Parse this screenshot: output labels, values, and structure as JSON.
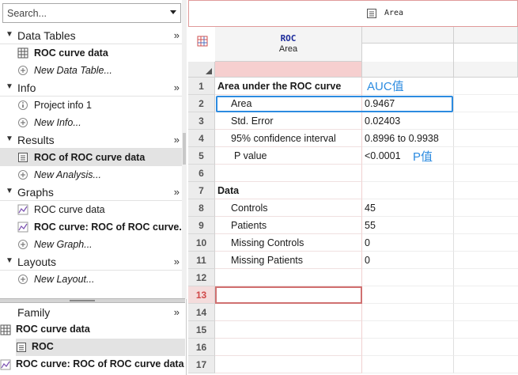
{
  "search": {
    "placeholder": "Search..."
  },
  "sections": [
    {
      "title": "Data Tables",
      "more": "»",
      "items": [
        {
          "label": "ROC curve data"
        },
        {
          "label": "New Data Table..."
        }
      ]
    },
    {
      "title": "Info",
      "more": "»",
      "items": [
        {
          "label": "Project info 1"
        },
        {
          "label": "New Info..."
        }
      ]
    },
    {
      "title": "Results",
      "more": "»",
      "items": [
        {
          "label": "ROC of ROC curve data"
        },
        {
          "label": "New Analysis..."
        }
      ]
    },
    {
      "title": "Graphs",
      "more": "»",
      "items": [
        {
          "label": "ROC curve data"
        },
        {
          "label": "ROC curve: ROC of ROC curve..."
        },
        {
          "label": "New Graph..."
        }
      ]
    },
    {
      "title": "Layouts",
      "more": "»",
      "items": [
        {
          "label": "New Layout..."
        }
      ]
    }
  ],
  "family": {
    "title": "Family",
    "more": "»",
    "items": [
      {
        "label": "ROC curve data"
      },
      {
        "label": "ROC"
      },
      {
        "label": "ROC curve: ROC of ROC curve data"
      }
    ]
  },
  "sheet": {
    "tab_title": "Area",
    "column_title": "ROC",
    "column_subtitle": "Area",
    "rows": [
      {
        "num": "1",
        "label": "Area under the ROC curve",
        "value": ""
      },
      {
        "num": "2",
        "label": "Area",
        "value": "0.9467"
      },
      {
        "num": "3",
        "label": "Std. Error",
        "value": "0.02403"
      },
      {
        "num": "4",
        "label": "95% confidence interval",
        "value": "0.8996 to 0.9938"
      },
      {
        "num": "5",
        "label": "P value",
        "value": "<0.0001"
      },
      {
        "num": "6",
        "label": "",
        "value": ""
      },
      {
        "num": "7",
        "label": "Data",
        "value": ""
      },
      {
        "num": "8",
        "label": "Controls",
        "value": "45"
      },
      {
        "num": "9",
        "label": "Patients",
        "value": "55"
      },
      {
        "num": "10",
        "label": "Missing Controls",
        "value": "0"
      },
      {
        "num": "11",
        "label": "Missing Patients",
        "value": "0"
      },
      {
        "num": "12",
        "label": "",
        "value": ""
      },
      {
        "num": "13",
        "label": "",
        "value": ""
      },
      {
        "num": "14",
        "label": "",
        "value": ""
      },
      {
        "num": "15",
        "label": "",
        "value": ""
      },
      {
        "num": "16",
        "label": "",
        "value": ""
      },
      {
        "num": "17",
        "label": "",
        "value": ""
      }
    ]
  },
  "annotations": {
    "auc": "AUC值",
    "p": "P值"
  },
  "colors": {
    "annotation": "#2c8be0",
    "current_row": "#d04848",
    "column_header_text": "#1a2a9a"
  }
}
